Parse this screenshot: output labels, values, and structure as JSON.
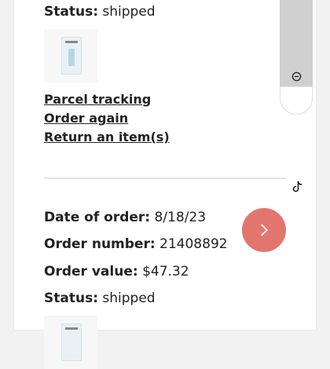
{
  "orders": [
    {
      "status_label": "Status:",
      "status_value": "shipped",
      "actions": {
        "tracking": "Parcel tracking",
        "again": "Order again",
        "return": "Return an item(s)"
      }
    },
    {
      "date_label": "Date of order:",
      "date_value": "8/18/23",
      "number_label": "Order number:",
      "number_value": "21408892",
      "value_label": "Order value:",
      "value_value": "$47.32",
      "status_label": "Status:",
      "status_value": "shipped"
    }
  ],
  "icons": {
    "next": "chevron-right-icon",
    "zoom_out": "zoom-out-icon",
    "tiktok": "tiktok-icon"
  },
  "colors": {
    "accent": "#e2766f",
    "panel": "#cfcfcf"
  }
}
